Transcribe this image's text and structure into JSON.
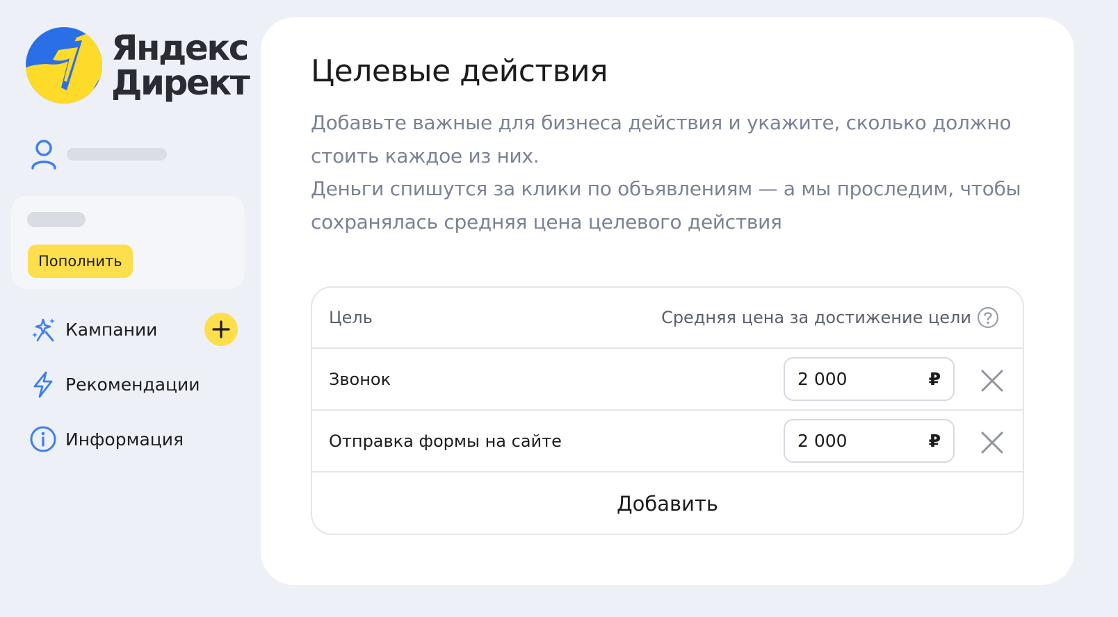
{
  "brand": {
    "line1": "Яндекс",
    "line2": "Директ",
    "colors": {
      "blue": "#2a6ee8",
      "yellow": "#fedb28"
    }
  },
  "sidebar": {
    "user_icon": "user-icon",
    "balance_card": {
      "topup_label": "Пополнить"
    },
    "nav": [
      {
        "label": "Кампании",
        "icon": "sparkles-icon",
        "action_icon": "plus-icon"
      },
      {
        "label": "Рекомендации",
        "icon": "lightning-icon"
      },
      {
        "label": "Информация",
        "icon": "info-icon"
      }
    ]
  },
  "main": {
    "title": "Целевые действия",
    "description": [
      "Добавьте важные для бизнеса действия и укажите, сколько должно стоить каждое из них.",
      "Деньги спишутся за клики по объявлениям — а мы проследим, чтобы сохранялась средняя цена целевого действия"
    ],
    "table": {
      "headers": {
        "goal": "Цель",
        "price": "Средняя цена за достижение цели",
        "help_icon": "question-circle-icon"
      },
      "rows": [
        {
          "goal": "Звонок",
          "price": "2 000",
          "currency": "₽",
          "remove_icon": "close-icon"
        },
        {
          "goal": "Отправка формы на сайте",
          "price": "2 000",
          "currency": "₽",
          "remove_icon": "close-icon"
        }
      ],
      "add_label": "Добавить"
    },
    "colors": {
      "accent_yellow": "#fdde4d",
      "icon_blue": "#3f7ef0",
      "muted_text": "#7a8294"
    }
  }
}
